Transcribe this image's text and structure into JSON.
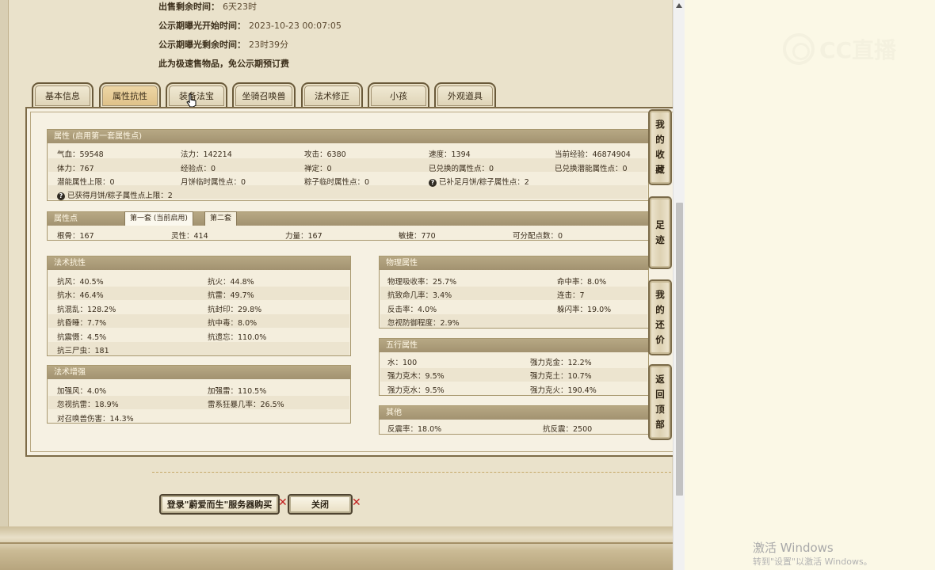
{
  "sale_info": [
    {
      "key": "出售剩余时间：",
      "value": "6天23时"
    },
    {
      "key": "公示期曝光开始时间：",
      "value": "2023-10-23 00:07:05"
    },
    {
      "key": "公示期曝光剩余时间：",
      "value": "23时39分"
    },
    {
      "key": "此为极速售物品，免公示期预订费",
      "value": ""
    }
  ],
  "tabs": [
    "基本信息",
    "属性抗性",
    "装备法宝",
    "坐骑召唤兽",
    "法术修正",
    "小孩",
    "外观道具"
  ],
  "attr_section": {
    "title": "属性 (启用第一套属性点)",
    "row1": [
      "气血：59548",
      "法力：142214",
      "攻击：6380",
      "速度：1394",
      "当前经验：46874904"
    ],
    "row2": [
      "体力：767",
      "经验点：0",
      "禅定：0",
      "已兑换的属性点：0",
      "已兑换潜能属性点：0"
    ],
    "row3": [
      "潜能属性上限：0",
      "月饼临时属性点：0",
      "粽子临时属性点：0",
      "已补足月饼/粽子属性点：2"
    ],
    "row4": "已获得月饼/粽子属性点上限：2"
  },
  "points_section": {
    "title": "属性点",
    "subtabs": [
      "第一套 (当前启用)",
      "第二套"
    ],
    "values": [
      "根骨：167",
      "灵性：414",
      "力量：167",
      "敏捷：770",
      "可分配点数：0"
    ]
  },
  "magic_resist": {
    "title": "法术抗性",
    "items": [
      "抗风：40.5%",
      "抗火：44.8%",
      "抗水：46.4%",
      "抗雷：49.7%",
      "抗混乱：128.2%",
      "抗封印：29.8%",
      "抗昏睡：7.7%",
      "抗中毒：8.0%",
      "抗震慑：4.5%",
      "抗遗忘：110.0%",
      "抗三尸虫：181"
    ]
  },
  "magic_boost": {
    "title": "法术增强",
    "items": [
      "加强风：4.0%",
      "加强雷：110.5%",
      "忽视抗雷：18.9%",
      "雷系狂暴几率：26.5%",
      "对召唤兽伤害：14.3%"
    ]
  },
  "physical": {
    "title": "物理属性",
    "items": [
      "物理吸收率：25.7%",
      "命中率：8.0%",
      "抗致命几率：3.4%",
      "连击：7",
      "反击率：4.0%",
      "躲闪率：19.0%",
      "忽视防御程度：2.9%"
    ]
  },
  "five_elements": {
    "title": "五行属性",
    "items": [
      "水：100",
      "强力克金：12.2%",
      "强力克木：9.5%",
      "强力克土：10.7%",
      "强力克水：9.5%",
      "强力克火：190.4%"
    ]
  },
  "other": {
    "title": "其他",
    "items": [
      "反震率：18.0%",
      "抗反震：2500"
    ]
  },
  "side_buttons": [
    "我的收藏",
    "足迹",
    "我的还价",
    "返回顶部"
  ],
  "actions": {
    "login_buy": "登录\"蔚爱而生\"服务器购买",
    "close": "关闭"
  },
  "logo_text": "CC直播",
  "windows_activation": {
    "line1": "激活 Windows",
    "line2": "转到\"设置\"以激活 Windows。"
  }
}
